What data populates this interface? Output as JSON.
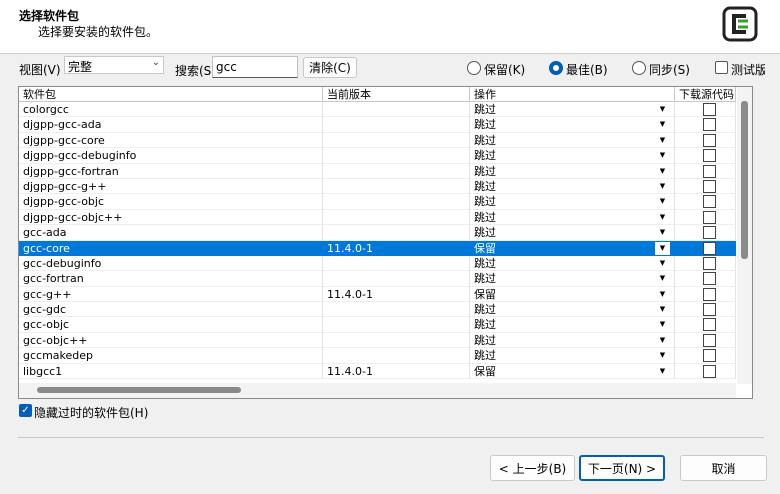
{
  "header": {
    "title": "选择软件包",
    "subtitle": "选择要安装的软件包。",
    "logo_icon": "cygwin-logo-icon",
    "accent": "#3aa02c"
  },
  "toolbar": {
    "view_label": "视图(V)",
    "view_value": "完整",
    "search_label": "搜索(S)",
    "search_value": "gcc",
    "clear_label": "清除(C)",
    "radio_keep": "保留(K)",
    "radio_best": "最佳(B)",
    "radio_sync": "同步(S)",
    "checkbox_test": "测试版"
  },
  "table": {
    "columns": [
      "软件包",
      "当前版本",
      "操作",
      "下载源代码?"
    ],
    "rows": [
      {
        "name": "colorgcc",
        "version": "",
        "action": "跳过"
      },
      {
        "name": "djgpp-gcc-ada",
        "version": "",
        "action": "跳过"
      },
      {
        "name": "djgpp-gcc-core",
        "version": "",
        "action": "跳过"
      },
      {
        "name": "djgpp-gcc-debuginfo",
        "version": "",
        "action": "跳过"
      },
      {
        "name": "djgpp-gcc-fortran",
        "version": "",
        "action": "跳过"
      },
      {
        "name": "djgpp-gcc-g++",
        "version": "",
        "action": "跳过"
      },
      {
        "name": "djgpp-gcc-objc",
        "version": "",
        "action": "跳过"
      },
      {
        "name": "djgpp-gcc-objc++",
        "version": "",
        "action": "跳过"
      },
      {
        "name": "gcc-ada",
        "version": "",
        "action": "跳过"
      },
      {
        "name": "gcc-core",
        "version": "11.4.0-1",
        "action": "保留"
      },
      {
        "name": "gcc-debuginfo",
        "version": "",
        "action": "跳过"
      },
      {
        "name": "gcc-fortran",
        "version": "",
        "action": "跳过"
      },
      {
        "name": "gcc-g++",
        "version": "11.4.0-1",
        "action": "保留"
      },
      {
        "name": "gcc-gdc",
        "version": "",
        "action": "跳过"
      },
      {
        "name": "gcc-objc",
        "version": "",
        "action": "跳过"
      },
      {
        "name": "gcc-objc++",
        "version": "",
        "action": "跳过"
      },
      {
        "name": "gccmakedep",
        "version": "",
        "action": "跳过"
      },
      {
        "name": "libgcc1",
        "version": "11.4.0-1",
        "action": "保留"
      }
    ]
  },
  "footer": {
    "hide_obsolete_label": "隐藏过时的软件包(H)",
    "back_label": "< 上一步(B)",
    "next_label": "下一页(N) >",
    "cancel_label": "取消"
  }
}
